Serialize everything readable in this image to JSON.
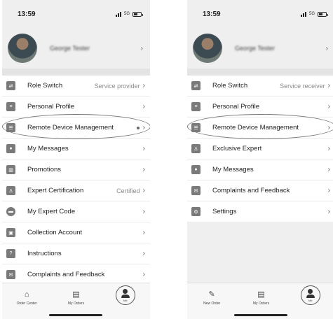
{
  "left": {
    "status": {
      "time": "13:59",
      "network": "5G"
    },
    "profile": {
      "name": "George Tester"
    },
    "menu": [
      {
        "label": "Role Switch",
        "value": "Service provider",
        "icon": "switch-icon"
      },
      {
        "label": "Personal Profile",
        "value": "",
        "icon": "profile-icon"
      },
      {
        "label": "Remote Device Management",
        "value": "",
        "icon": "device-icon",
        "badge_dot": true
      },
      {
        "label": "My Messages",
        "value": "",
        "icon": "message-icon"
      },
      {
        "label": "Promotions",
        "value": "",
        "icon": "gift-icon"
      },
      {
        "label": "Expert Certification",
        "value": "Certified",
        "icon": "certificate-icon"
      },
      {
        "label": "My Expert Code",
        "value": "",
        "icon": "code-icon"
      },
      {
        "label": "Collection Account",
        "value": "",
        "icon": "wallet-icon"
      },
      {
        "label": "Instructions",
        "value": "",
        "icon": "help-icon"
      },
      {
        "label": "Complaints and Feedback",
        "value": "",
        "icon": "mail-icon"
      }
    ],
    "tabs": [
      {
        "label": "Order Center",
        "icon": "home-icon"
      },
      {
        "label": "My Orders",
        "icon": "clipboard-icon"
      },
      {
        "label": "Me",
        "icon": "person-icon"
      }
    ]
  },
  "right": {
    "status": {
      "time": "13:59",
      "network": "5G"
    },
    "profile": {
      "name": "George Tester"
    },
    "menu": [
      {
        "label": "Role Switch",
        "value": "Service receiver",
        "icon": "switch-icon"
      },
      {
        "label": "Personal Profile",
        "value": "",
        "icon": "profile-icon"
      },
      {
        "label": "Remote Device Management",
        "value": "",
        "icon": "device-icon"
      },
      {
        "label": "Exclusive Expert",
        "value": "",
        "icon": "expert-icon"
      },
      {
        "label": "My Messages",
        "value": "",
        "icon": "message-icon"
      },
      {
        "label": "Complaints and Feedback",
        "value": "",
        "icon": "mail-icon"
      },
      {
        "label": "Settings",
        "value": "",
        "icon": "settings-icon"
      }
    ],
    "tabs": [
      {
        "label": "New Order",
        "icon": "edit-icon"
      },
      {
        "label": "My Orders",
        "icon": "clipboard-icon"
      },
      {
        "label": "Me",
        "icon": "person-icon"
      }
    ]
  },
  "chevron": "›"
}
